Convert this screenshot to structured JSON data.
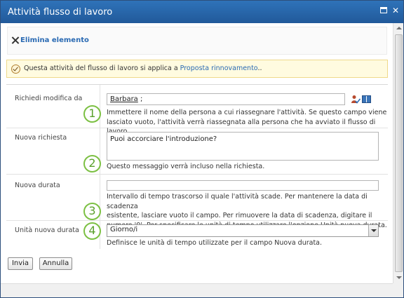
{
  "window": {
    "title": "Attività flusso di lavoro",
    "maximize_icon": "maximize-icon",
    "close_icon": "close-icon"
  },
  "ribbon": {
    "delete_label": "Elimina elemento",
    "delete_icon": "delete-x-icon"
  },
  "notice": {
    "icon": "task-check-icon",
    "text": "Questa attività del flusso di lavoro si applica a",
    "link": "Proposta rinnovamento",
    "suffix": ".."
  },
  "form": {
    "reassign": {
      "label": "Richiedi modifica da",
      "value": "Barbara",
      "value_suffix": " ;",
      "badge": "1",
      "desc_line1": "Immettere il nome della persona a cui riassegnare l'attività. Se questo campo viene",
      "desc_line2": "lasciato vuoto, l'attività verrà riassegnata alla persona che ha avviato il flusso di lavoro.",
      "check_names_icon": "check-names-icon",
      "browse_icon": "address-book-icon"
    },
    "request": {
      "label": "Nuova richiesta",
      "value": "Puoi accorciare l'introduzione?",
      "badge": "2",
      "desc": "Questo messaggio verrà incluso nella richiesta."
    },
    "duration": {
      "label": "Nuova durata",
      "value": "",
      "badge": "3",
      "desc_line1": "Intervallo di tempo trascorso il quale l'attività scade. Per mantenere la data di scadenza",
      "desc_line2": "esistente, lasciare vuoto il campo. Per rimuovere la data di scadenza, digitare il",
      "desc_line3": "numero '0'. Per specificare le unità di tempo utilizzare l'opzione Unità nuova durata."
    },
    "units": {
      "label": "Unità nuova durata",
      "selected": "Giorno/i",
      "badge": "4",
      "desc": "Definisce le unità di tempo utilizzate per il campo Nuova durata."
    }
  },
  "buttons": {
    "submit": "Invia",
    "cancel": "Annulla"
  },
  "colors": {
    "titlebar": "#2a66a8",
    "badge_green": "#7cc043",
    "link_blue": "#2a6ab3",
    "notice_bg": "#fffbe0"
  }
}
